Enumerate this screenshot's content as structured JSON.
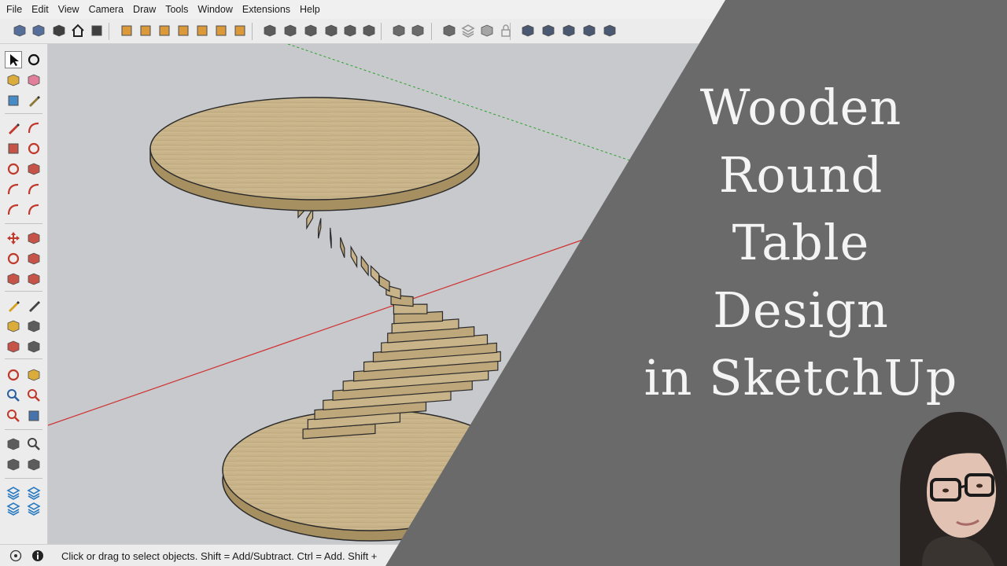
{
  "menu": [
    "File",
    "Edit",
    "View",
    "Camera",
    "Draw",
    "Tools",
    "Window",
    "Extensions",
    "Help"
  ],
  "top_toolbar": [
    {
      "icon": "get-models-icon",
      "color": "#3d5a8c"
    },
    {
      "icon": "share-model-icon",
      "color": "#3d5a8c"
    },
    {
      "icon": "warehouse-icon",
      "color": "#222222"
    },
    {
      "icon": "home-icon",
      "color": "#222222"
    },
    {
      "icon": "component-icon",
      "color": "#222222"
    },
    {
      "icon": "iso-view-icon",
      "color": "#d98c1a"
    },
    {
      "icon": "top-view-icon",
      "color": "#d98c1a"
    },
    {
      "icon": "front-view-icon",
      "color": "#d98c1a"
    },
    {
      "icon": "right-view-icon",
      "color": "#d98c1a"
    },
    {
      "icon": "back-view-icon",
      "color": "#d98c1a"
    },
    {
      "icon": "left-view-icon",
      "color": "#d98c1a"
    },
    {
      "icon": "bottom-view-icon",
      "color": "#d98c1a"
    },
    {
      "icon": "xray-icon",
      "color": "#444444"
    },
    {
      "icon": "back-edges-icon",
      "color": "#444444"
    },
    {
      "icon": "wireframe-icon",
      "color": "#444444"
    },
    {
      "icon": "hidden-line-icon",
      "color": "#444444"
    },
    {
      "icon": "shaded-icon",
      "color": "#444444"
    },
    {
      "icon": "shaded-textures-icon",
      "color": "#444444"
    },
    {
      "icon": "section-plane-icon",
      "color": "#555555"
    },
    {
      "icon": "display-section-icon",
      "color": "#555555"
    },
    {
      "icon": "outliner-icon",
      "color": "#555555"
    },
    {
      "icon": "layers-icon",
      "color": "#999999"
    },
    {
      "icon": "scenes-icon",
      "color": "#999999"
    },
    {
      "icon": "lock-icon",
      "color": "#999999"
    },
    {
      "icon": "extension-a-icon",
      "color": "#2e3f5c"
    },
    {
      "icon": "extension-b-icon",
      "color": "#2e3f5c"
    },
    {
      "icon": "extension-c-icon",
      "color": "#2e3f5c"
    },
    {
      "icon": "extension-d-icon",
      "color": "#2e3f5c"
    },
    {
      "icon": "extension-e-icon",
      "color": "#2e3f5c"
    }
  ],
  "left_toolbar": [
    {
      "icon": "select-icon",
      "color": "#111111",
      "active": true
    },
    {
      "icon": "orbit-hand-icon",
      "color": "#111111"
    },
    {
      "icon": "paint-bucket-icon",
      "color": "#d6a21e"
    },
    {
      "icon": "eraser-icon",
      "color": "#e06c8c"
    },
    {
      "icon": "component-tool-icon",
      "color": "#2a7ac0"
    },
    {
      "icon": "tape-icon",
      "color": "#8a7a3a"
    },
    {
      "icon": "pencil-icon",
      "color": "#c0392b"
    },
    {
      "icon": "freehand-icon",
      "color": "#c0392b"
    },
    {
      "icon": "rectangle-icon",
      "color": "#c0392b"
    },
    {
      "icon": "rotated-rectangle-icon",
      "color": "#c0392b"
    },
    {
      "icon": "circle-icon",
      "color": "#c0392b"
    },
    {
      "icon": "polygon-icon",
      "color": "#c0392b"
    },
    {
      "icon": "arc-icon",
      "color": "#c0392b"
    },
    {
      "icon": "two-point-arc-icon",
      "color": "#c0392b"
    },
    {
      "icon": "three-point-arc-icon",
      "color": "#c0392b"
    },
    {
      "icon": "pie-icon",
      "color": "#c0392b"
    },
    {
      "icon": "move-icon",
      "color": "#c0392b"
    },
    {
      "icon": "push-pull-icon",
      "color": "#c0392b"
    },
    {
      "icon": "rotate-icon",
      "color": "#c0392b"
    },
    {
      "icon": "follow-me-icon",
      "color": "#c0392b"
    },
    {
      "icon": "scale-icon",
      "color": "#c0392b"
    },
    {
      "icon": "offset-icon",
      "color": "#c0392b"
    },
    {
      "icon": "tape-measure-icon",
      "color": "#d6a21e"
    },
    {
      "icon": "dimension-icon",
      "color": "#444444"
    },
    {
      "icon": "protractor-icon",
      "color": "#d6a21e"
    },
    {
      "icon": "text-icon",
      "color": "#444444"
    },
    {
      "icon": "axes-icon",
      "color": "#c0392b"
    },
    {
      "icon": "3d-text-icon",
      "color": "#444444"
    },
    {
      "icon": "orbit-icon",
      "color": "#c0392b"
    },
    {
      "icon": "pan-icon",
      "color": "#d6a21e"
    },
    {
      "icon": "zoom-icon",
      "color": "#2a5fa0"
    },
    {
      "icon": "zoom-window-icon",
      "color": "#c0392b"
    },
    {
      "icon": "zoom-extents-icon",
      "color": "#c0392b"
    },
    {
      "icon": "previous-view-icon",
      "color": "#2a5fa0"
    },
    {
      "icon": "position-camera-icon",
      "color": "#444444"
    },
    {
      "icon": "look-around-icon",
      "color": "#444444"
    },
    {
      "icon": "walk-icon",
      "color": "#444444"
    },
    {
      "icon": "section-plane-tool-icon",
      "color": "#444444"
    },
    {
      "icon": "sandbox-contours-icon",
      "color": "#2a7ac0"
    },
    {
      "icon": "sandbox-scratch-icon",
      "color": "#2a7ac0"
    },
    {
      "icon": "sandbox-smoove-icon",
      "color": "#2a7ac0"
    },
    {
      "icon": "sandbox-stamp-icon",
      "color": "#2a7ac0"
    }
  ],
  "status": {
    "info_icon": "info-icon",
    "help_icon": "help-circle-icon",
    "message": "Click or drag to select objects. Shift = Add/Subtract. Ctrl = Add. Shift +"
  },
  "overlay": {
    "title_lines": [
      "Wooden",
      "Round",
      "Table",
      "Design",
      "in SketchUp"
    ],
    "background": "#6a6a6a",
    "text_color": "#f4f4f4"
  },
  "scene": {
    "sky_color": "#c7c9cc",
    "wood_top": "#c9b48a",
    "wood_edge": "#a68f60",
    "axis_red": "#d03030",
    "axis_green": "#2aa02a",
    "spiral_steps": 26
  }
}
